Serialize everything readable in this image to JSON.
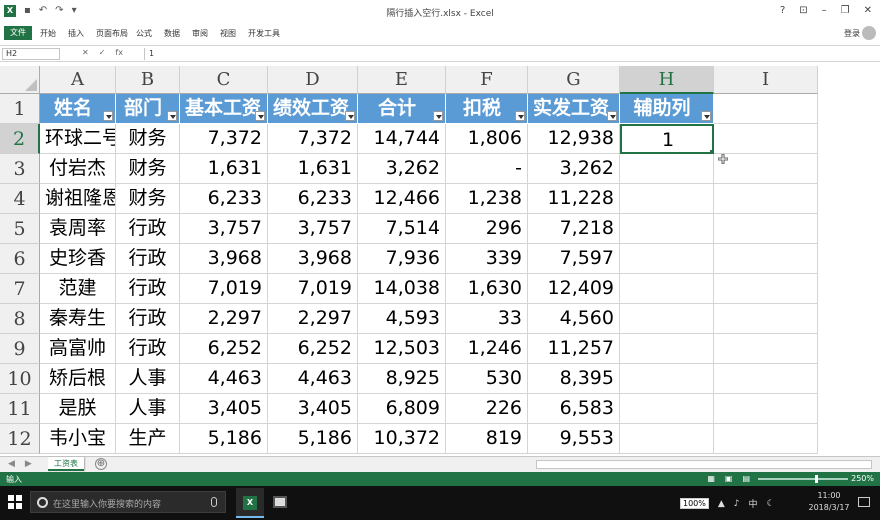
{
  "window": {
    "title": "隔行插入空行.xlsx - Excel",
    "help": "?",
    "minimize": "–",
    "restore": "❐",
    "close": "✕",
    "ribbon_toggle": "⊡"
  },
  "ribbon": {
    "file": "文件",
    "tabs": [
      "开始",
      "插入",
      "页面布局",
      "公式",
      "数据",
      "审阅",
      "视图",
      "开发工具"
    ],
    "login": "登录"
  },
  "formula_bar": {
    "name_box": "H2",
    "cancel": "✕",
    "enter": "✓",
    "fx": "fx",
    "value": "1"
  },
  "columns": [
    "A",
    "B",
    "C",
    "D",
    "E",
    "F",
    "G",
    "H",
    "I"
  ],
  "rows": [
    "1",
    "2",
    "3",
    "4",
    "5",
    "6",
    "7",
    "8",
    "9",
    "10",
    "11",
    "12"
  ],
  "table": {
    "headers": [
      "姓名",
      "部门",
      "基本工资",
      "绩效工资",
      "合计",
      "扣税",
      "实发工资",
      "辅助列"
    ],
    "data": [
      [
        "环球二号",
        "财务",
        "7,372",
        "7,372",
        "14,744",
        "1,806",
        "12,938",
        "1"
      ],
      [
        "付岩杰",
        "财务",
        "1,631",
        "1,631",
        "3,262",
        "-",
        "3,262",
        ""
      ],
      [
        "谢祖隆恩",
        "财务",
        "6,233",
        "6,233",
        "12,466",
        "1,238",
        "11,228",
        ""
      ],
      [
        "袁周率",
        "行政",
        "3,757",
        "3,757",
        "7,514",
        "296",
        "7,218",
        ""
      ],
      [
        "史珍香",
        "行政",
        "3,968",
        "3,968",
        "7,936",
        "339",
        "7,597",
        ""
      ],
      [
        "范建",
        "行政",
        "7,019",
        "7,019",
        "14,038",
        "1,630",
        "12,409",
        ""
      ],
      [
        "秦寿生",
        "行政",
        "2,297",
        "2,297",
        "4,593",
        "33",
        "4,560",
        ""
      ],
      [
        "高富帅",
        "行政",
        "6,252",
        "6,252",
        "12,503",
        "1,246",
        "11,257",
        ""
      ],
      [
        "矫后根",
        "人事",
        "4,463",
        "4,463",
        "8,925",
        "530",
        "8,395",
        ""
      ],
      [
        "是朕",
        "人事",
        "3,405",
        "3,405",
        "6,809",
        "226",
        "6,583",
        ""
      ],
      [
        "韦小宝",
        "生产",
        "5,186",
        "5,186",
        "10,372",
        "819",
        "9,553",
        ""
      ]
    ]
  },
  "sheet_tabs": {
    "active": "工资表",
    "add": "⊕",
    "nav_prev": "◀",
    "nav_next": "▶"
  },
  "status": {
    "mode": "输入",
    "zoom": "250%",
    "view_normal": "▦",
    "view_layout": "▣",
    "view_break": "▤"
  },
  "taskbar": {
    "search_placeholder": "在这里输入你要搜索的内容",
    "zoom_badge": "100%",
    "ime": "中",
    "time": "11:00",
    "date": "2018/3/17"
  },
  "colors": {
    "excel_green": "#217346",
    "header_blue": "#5b9bd5"
  }
}
